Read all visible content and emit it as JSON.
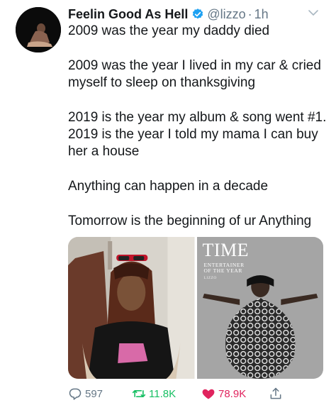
{
  "tweet": {
    "display_name": "Feelin Good As Hell",
    "handle": "@lizzo",
    "separator": "·",
    "timestamp": "1h",
    "text": {
      "p1": "2009 was the year my daddy died",
      "p2": "2009 was the year I lived in my car & cried myself to sleep on thanksgiving",
      "p3": "2019 is the year my album & song went #1. 2019 is the year I told my mama I can buy her a house",
      "p4": "Anything can happen in a decade",
      "p5": "Tomorrow is the beginning of ur Anything"
    },
    "media": {
      "time_cover": {
        "logo": "TIME",
        "line1": "Entertainer",
        "line2": "of the Year",
        "name": "LIZZO"
      }
    },
    "actions": {
      "replies": "597",
      "retweets": "11.8K",
      "likes": "78.9K"
    },
    "icons": {
      "verified": "verified-badge-icon",
      "caret": "chevron-down-icon",
      "reply": "reply-icon",
      "retweet": "retweet-icon",
      "like": "heart-icon",
      "share": "share-icon"
    },
    "colors": {
      "verified": "#1da1f2",
      "retweet_active": "#17bf63",
      "like_active": "#e0245e",
      "secondary_text": "#657786"
    }
  }
}
